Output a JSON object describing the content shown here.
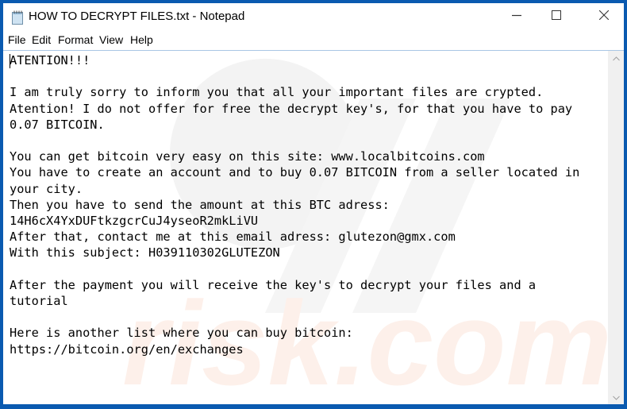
{
  "window": {
    "title": "HOW TO DECRYPT FILES.txt - Notepad",
    "app_icon": "notepad-icon",
    "controls": {
      "minimize": "minimize-icon",
      "maximize": "maximize-icon",
      "close": "close-icon"
    }
  },
  "menu": {
    "items": [
      {
        "label": "File"
      },
      {
        "label": "Edit"
      },
      {
        "label": "Format"
      },
      {
        "label": "View"
      },
      {
        "label": "Help"
      }
    ]
  },
  "editor": {
    "lines": [
      "ATENTION!!!",
      "",
      "I am truly sorry to inform you that all your important files are crypted.",
      "Atention! I do not offer for free the decrypt key's, for that you have to pay",
      "0.07 BITCOIN.",
      "",
      "You can get bitcoin very easy on this site: www.localbitcoins.com",
      "You have to create an account and to buy 0.07 BITCOIN from a seller located in",
      "your city.",
      "Then you have to send the amount at this BTC adress:",
      "14H6cX4YxDUFtkzgcrCuJ4yseoR2mkLiVU",
      "After that, contact me at this email adress: glutezon@gmx.com",
      "With this subject: H039110302GLUTEZON",
      "",
      "After the payment you will receive the key's to decrypt your files and a",
      "tutorial",
      "",
      "Here is another list where you can buy bitcoin:",
      "https://bitcoin.org/en/exchanges"
    ]
  },
  "scrollbar": {
    "up": "chevron-up-icon",
    "down": "chevron-down-icon"
  },
  "colors": {
    "frame": "#0a5ab0",
    "menu_border": "#a9c6e4",
    "scrollbar": "#f0f0f0"
  }
}
